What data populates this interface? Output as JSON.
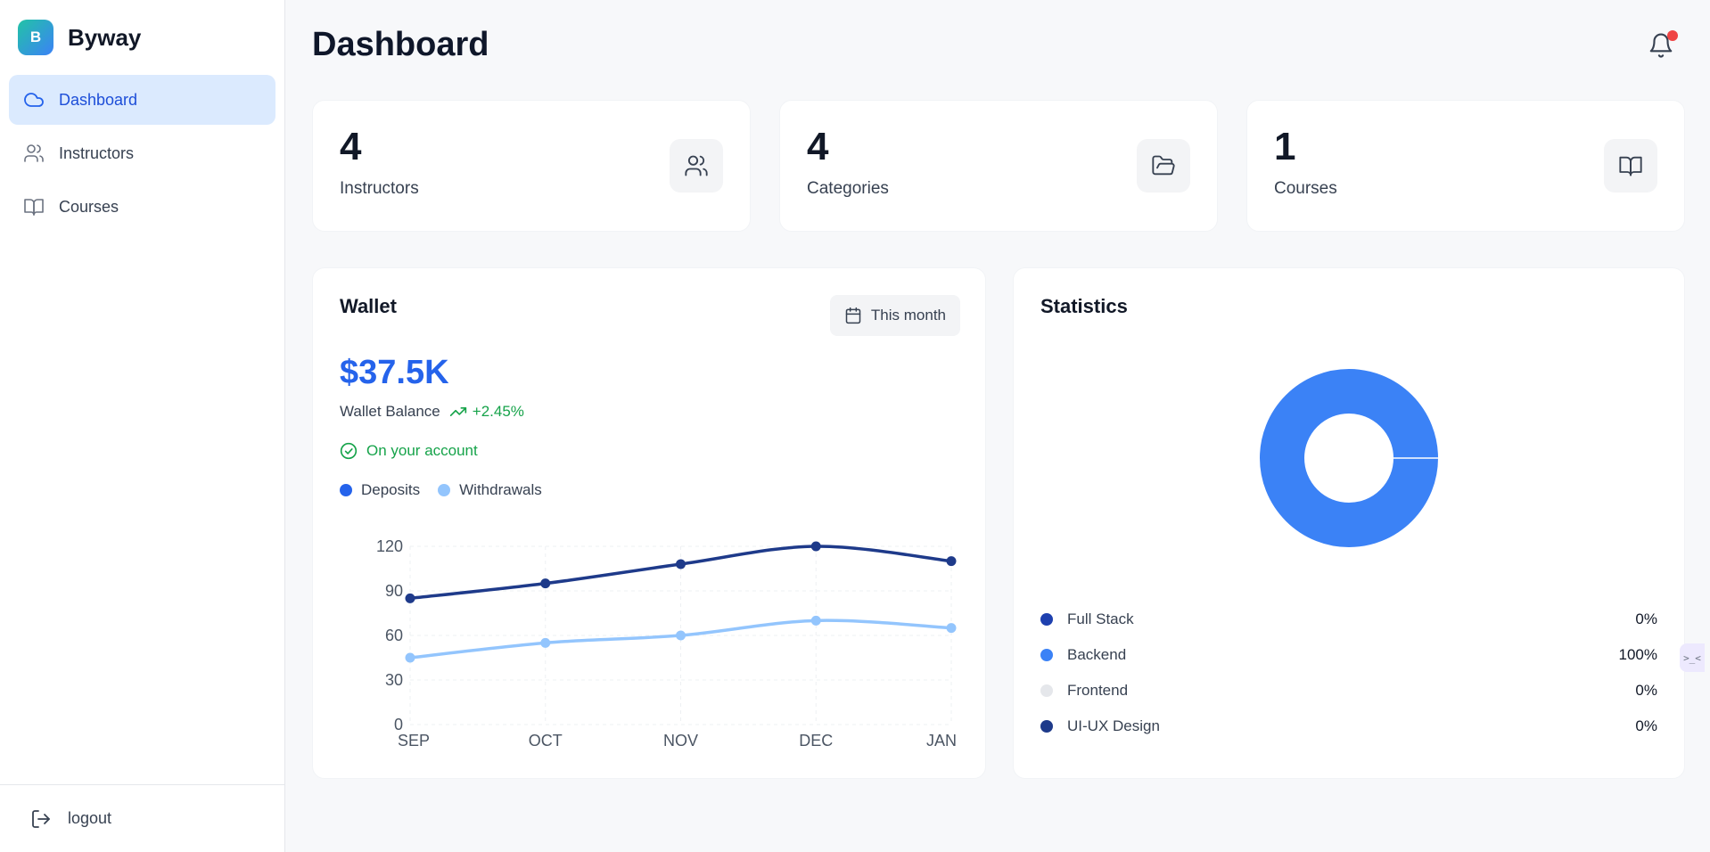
{
  "brand": {
    "logo_letter": "B",
    "name": "Byway"
  },
  "sidebar": {
    "items": [
      {
        "label": "Dashboard",
        "icon": "cloud-icon",
        "active": true
      },
      {
        "label": "Instructors",
        "icon": "users-icon",
        "active": false
      },
      {
        "label": "Courses",
        "icon": "book-icon",
        "active": false
      }
    ],
    "logout_label": "logout"
  },
  "header": {
    "title": "Dashboard",
    "notification_icon": "bell-icon",
    "has_unread": true
  },
  "stats": [
    {
      "value": "4",
      "label": "Instructors",
      "icon": "users-icon"
    },
    {
      "value": "4",
      "label": "Categories",
      "icon": "folder-open-icon"
    },
    {
      "value": "1",
      "label": "Courses",
      "icon": "book-open-icon"
    }
  ],
  "wallet": {
    "title": "Wallet",
    "period_label": "This month",
    "amount": "$37.5K",
    "balance_label": "Wallet Balance",
    "change": "+2.45%",
    "account_note": "On your account",
    "legend": {
      "deposits": "Deposits",
      "withdrawals": "Withdrawals"
    }
  },
  "statistics": {
    "title": "Statistics",
    "items": [
      {
        "label": "Full Stack",
        "pct": "0%",
        "color": "#1e40af"
      },
      {
        "label": "Backend",
        "pct": "100%",
        "color": "#3b82f6"
      },
      {
        "label": "Frontend",
        "pct": "0%",
        "color": "#e5e7eb"
      },
      {
        "label": "UI-UX Design",
        "pct": "0%",
        "color": "#1e3a8a"
      }
    ]
  },
  "colors": {
    "accent": "#2563eb",
    "active_bg": "#dbeafe",
    "positive": "#16a34a",
    "deposits": "#1e3a8a",
    "withdrawals": "#93c5fd",
    "notification": "#ef4444"
  },
  "chart_data": {
    "type": "line",
    "categories": [
      "SEP",
      "OCT",
      "NOV",
      "DEC",
      "JAN"
    ],
    "series": [
      {
        "name": "Deposits",
        "values": [
          85,
          95,
          108,
          120,
          110
        ]
      },
      {
        "name": "Withdrawals",
        "values": [
          45,
          55,
          60,
          70,
          65
        ]
      }
    ],
    "yticks": [
      0,
      30,
      60,
      90,
      120
    ],
    "ylim": [
      0,
      120
    ],
    "grid": true,
    "legend": "top-left"
  }
}
